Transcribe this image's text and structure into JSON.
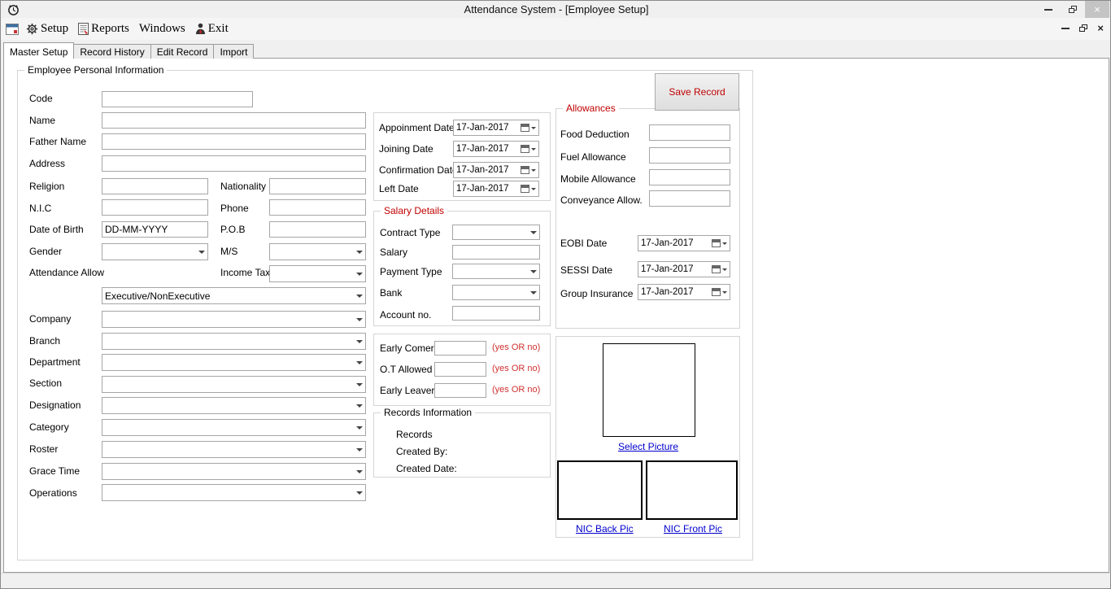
{
  "window": {
    "title": "Attendance System - [Employee Setup]"
  },
  "icons": {
    "close": "×",
    "mdi_close": "×"
  },
  "menu": {
    "setup": "Setup",
    "reports": "Reports",
    "windows": "Windows",
    "exit": "Exit"
  },
  "tabs": [
    {
      "label": "Master Setup",
      "active": true
    },
    {
      "label": "Record History",
      "active": false
    },
    {
      "label": "Edit Record",
      "active": false
    },
    {
      "label": "Import",
      "active": false
    }
  ],
  "groups": {
    "personal": "Employee Personal Information",
    "salary": "Salary Details",
    "records": "Records Information",
    "allowances": "Allowances"
  },
  "buttons": {
    "save": "Save Record"
  },
  "links": {
    "select_picture": "Select Picture",
    "nic_back": "NIC Back Pic",
    "nic_front": "NIC Front Pic"
  },
  "labels": {
    "code": "Code",
    "name": "Name",
    "father_name": "Father Name",
    "address": "Address",
    "religion": "Religion",
    "nationality": "Nationality",
    "nic": "N.I.C",
    "phone": "Phone",
    "dob": "Date of Birth",
    "pob": "P.O.B",
    "gender": "Gender",
    "ms": "M/S",
    "attendance_allow": "Attendance Allow",
    "income_tax": "Income Tax",
    "company": "Company",
    "branch": "Branch",
    "department": "Department",
    "section": "Section",
    "designation": "Designation",
    "category": "Category",
    "roster": "Roster",
    "grace_time": "Grace Time",
    "operations": "Operations",
    "appointment_date": "Appoinment Date",
    "joining_date": "Joining Date",
    "confirmation_date": "Confirmation Date",
    "left_date": "Left Date",
    "contract_type": "Contract Type",
    "salary": "Salary",
    "payment_type": "Payment Type",
    "bank": "Bank",
    "account_no": "Account no.",
    "early_comer": "Early Comer",
    "ot_allowed": "O.T Allowed",
    "early_leaver": "Early Leaver",
    "records": "Records",
    "created_by": "Created By:",
    "created_date": "Created Date:",
    "food_deduction": "Food Deduction",
    "fuel_allowance": "Fuel Allowance",
    "mobile_allowance": "Mobile Allowance",
    "conveyance_allow": "Conveyance Allow.",
    "eobi_date": "EOBI Date",
    "sessi_date": "SESSI Date",
    "group_insurance": "Group Insurance"
  },
  "hints": {
    "yes_or_no": "(yes OR no)"
  },
  "values": {
    "dob": "DD-MM-YYYY",
    "executive": "Executive/NonExecutive",
    "appointment_date": "17-Jan-2017",
    "joining_date": "17-Jan-2017",
    "confirmation_date": "17-Jan-2017",
    "left_date": "17-Jan-2017",
    "eobi_date": "17-Jan-2017",
    "sessi_date": "17-Jan-2017",
    "group_insurance_date": "17-Jan-2017"
  },
  "colors": {
    "accent_red": "#c00000",
    "link_blue": "#0000cc"
  }
}
